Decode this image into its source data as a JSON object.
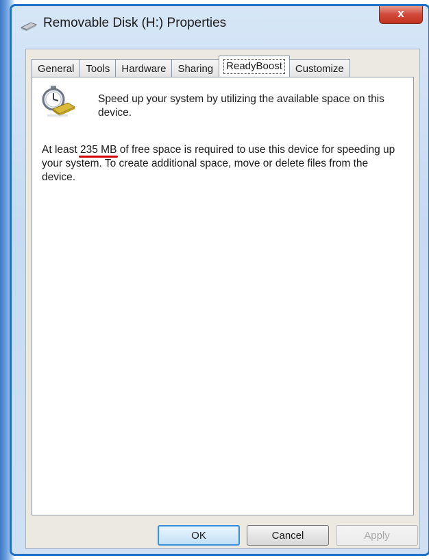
{
  "window": {
    "title": "Removable Disk (H:) Properties",
    "close_label": "x"
  },
  "tabs": [
    {
      "label": "General",
      "active": false
    },
    {
      "label": "Tools",
      "active": false
    },
    {
      "label": "Hardware",
      "active": false
    },
    {
      "label": "Sharing",
      "active": false
    },
    {
      "label": "ReadyBoost",
      "active": true
    },
    {
      "label": "Customize",
      "active": false
    }
  ],
  "readyboost": {
    "icon": "readyboost-stopwatch-drive-icon",
    "intro": "Speed up your system by utilizing the available space on this device.",
    "message_prefix": "At least ",
    "required_space": "235 MB",
    "message_suffix": " of free space is required to use this device for speeding up your system.  To create additional space, move or delete files from the device."
  },
  "buttons": {
    "ok": "OK",
    "cancel": "Cancel",
    "apply": "Apply"
  },
  "colors": {
    "highlight_underline": "#d40000",
    "window_border": "#1f6fc4"
  }
}
